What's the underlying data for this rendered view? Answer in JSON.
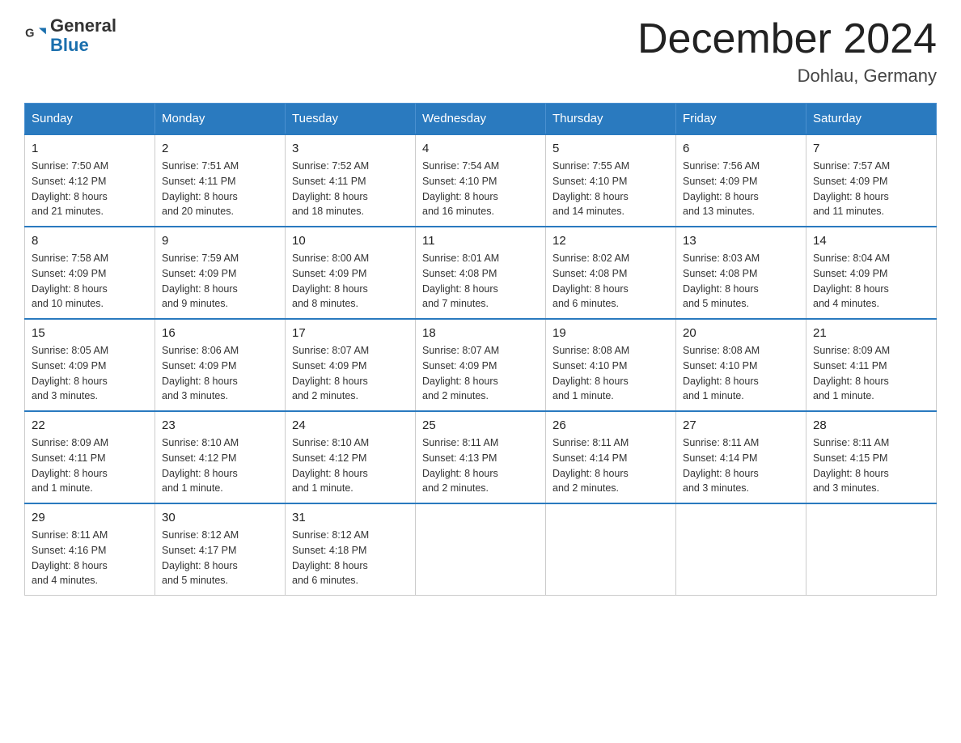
{
  "header": {
    "logo_text_general": "General",
    "logo_text_blue": "Blue",
    "month_title": "December 2024",
    "location": "Dohlau, Germany"
  },
  "days_of_week": [
    "Sunday",
    "Monday",
    "Tuesday",
    "Wednesday",
    "Thursday",
    "Friday",
    "Saturday"
  ],
  "weeks": [
    [
      {
        "day": "1",
        "sunrise": "7:50 AM",
        "sunset": "4:12 PM",
        "daylight": "8 hours and 21 minutes."
      },
      {
        "day": "2",
        "sunrise": "7:51 AM",
        "sunset": "4:11 PM",
        "daylight": "8 hours and 20 minutes."
      },
      {
        "day": "3",
        "sunrise": "7:52 AM",
        "sunset": "4:11 PM",
        "daylight": "8 hours and 18 minutes."
      },
      {
        "day": "4",
        "sunrise": "7:54 AM",
        "sunset": "4:10 PM",
        "daylight": "8 hours and 16 minutes."
      },
      {
        "day": "5",
        "sunrise": "7:55 AM",
        "sunset": "4:10 PM",
        "daylight": "8 hours and 14 minutes."
      },
      {
        "day": "6",
        "sunrise": "7:56 AM",
        "sunset": "4:09 PM",
        "daylight": "8 hours and 13 minutes."
      },
      {
        "day": "7",
        "sunrise": "7:57 AM",
        "sunset": "4:09 PM",
        "daylight": "8 hours and 11 minutes."
      }
    ],
    [
      {
        "day": "8",
        "sunrise": "7:58 AM",
        "sunset": "4:09 PM",
        "daylight": "8 hours and 10 minutes."
      },
      {
        "day": "9",
        "sunrise": "7:59 AM",
        "sunset": "4:09 PM",
        "daylight": "8 hours and 9 minutes."
      },
      {
        "day": "10",
        "sunrise": "8:00 AM",
        "sunset": "4:09 PM",
        "daylight": "8 hours and 8 minutes."
      },
      {
        "day": "11",
        "sunrise": "8:01 AM",
        "sunset": "4:08 PM",
        "daylight": "8 hours and 7 minutes."
      },
      {
        "day": "12",
        "sunrise": "8:02 AM",
        "sunset": "4:08 PM",
        "daylight": "8 hours and 6 minutes."
      },
      {
        "day": "13",
        "sunrise": "8:03 AM",
        "sunset": "4:08 PM",
        "daylight": "8 hours and 5 minutes."
      },
      {
        "day": "14",
        "sunrise": "8:04 AM",
        "sunset": "4:09 PM",
        "daylight": "8 hours and 4 minutes."
      }
    ],
    [
      {
        "day": "15",
        "sunrise": "8:05 AM",
        "sunset": "4:09 PM",
        "daylight": "8 hours and 3 minutes."
      },
      {
        "day": "16",
        "sunrise": "8:06 AM",
        "sunset": "4:09 PM",
        "daylight": "8 hours and 3 minutes."
      },
      {
        "day": "17",
        "sunrise": "8:07 AM",
        "sunset": "4:09 PM",
        "daylight": "8 hours and 2 minutes."
      },
      {
        "day": "18",
        "sunrise": "8:07 AM",
        "sunset": "4:09 PM",
        "daylight": "8 hours and 2 minutes."
      },
      {
        "day": "19",
        "sunrise": "8:08 AM",
        "sunset": "4:10 PM",
        "daylight": "8 hours and 1 minute."
      },
      {
        "day": "20",
        "sunrise": "8:08 AM",
        "sunset": "4:10 PM",
        "daylight": "8 hours and 1 minute."
      },
      {
        "day": "21",
        "sunrise": "8:09 AM",
        "sunset": "4:11 PM",
        "daylight": "8 hours and 1 minute."
      }
    ],
    [
      {
        "day": "22",
        "sunrise": "8:09 AM",
        "sunset": "4:11 PM",
        "daylight": "8 hours and 1 minute."
      },
      {
        "day": "23",
        "sunrise": "8:10 AM",
        "sunset": "4:12 PM",
        "daylight": "8 hours and 1 minute."
      },
      {
        "day": "24",
        "sunrise": "8:10 AM",
        "sunset": "4:12 PM",
        "daylight": "8 hours and 1 minute."
      },
      {
        "day": "25",
        "sunrise": "8:11 AM",
        "sunset": "4:13 PM",
        "daylight": "8 hours and 2 minutes."
      },
      {
        "day": "26",
        "sunrise": "8:11 AM",
        "sunset": "4:14 PM",
        "daylight": "8 hours and 2 minutes."
      },
      {
        "day": "27",
        "sunrise": "8:11 AM",
        "sunset": "4:14 PM",
        "daylight": "8 hours and 3 minutes."
      },
      {
        "day": "28",
        "sunrise": "8:11 AM",
        "sunset": "4:15 PM",
        "daylight": "8 hours and 3 minutes."
      }
    ],
    [
      {
        "day": "29",
        "sunrise": "8:11 AM",
        "sunset": "4:16 PM",
        "daylight": "8 hours and 4 minutes."
      },
      {
        "day": "30",
        "sunrise": "8:12 AM",
        "sunset": "4:17 PM",
        "daylight": "8 hours and 5 minutes."
      },
      {
        "day": "31",
        "sunrise": "8:12 AM",
        "sunset": "4:18 PM",
        "daylight": "8 hours and 6 minutes."
      },
      null,
      null,
      null,
      null
    ]
  ],
  "labels": {
    "sunrise": "Sunrise:",
    "sunset": "Sunset:",
    "daylight": "Daylight:"
  }
}
